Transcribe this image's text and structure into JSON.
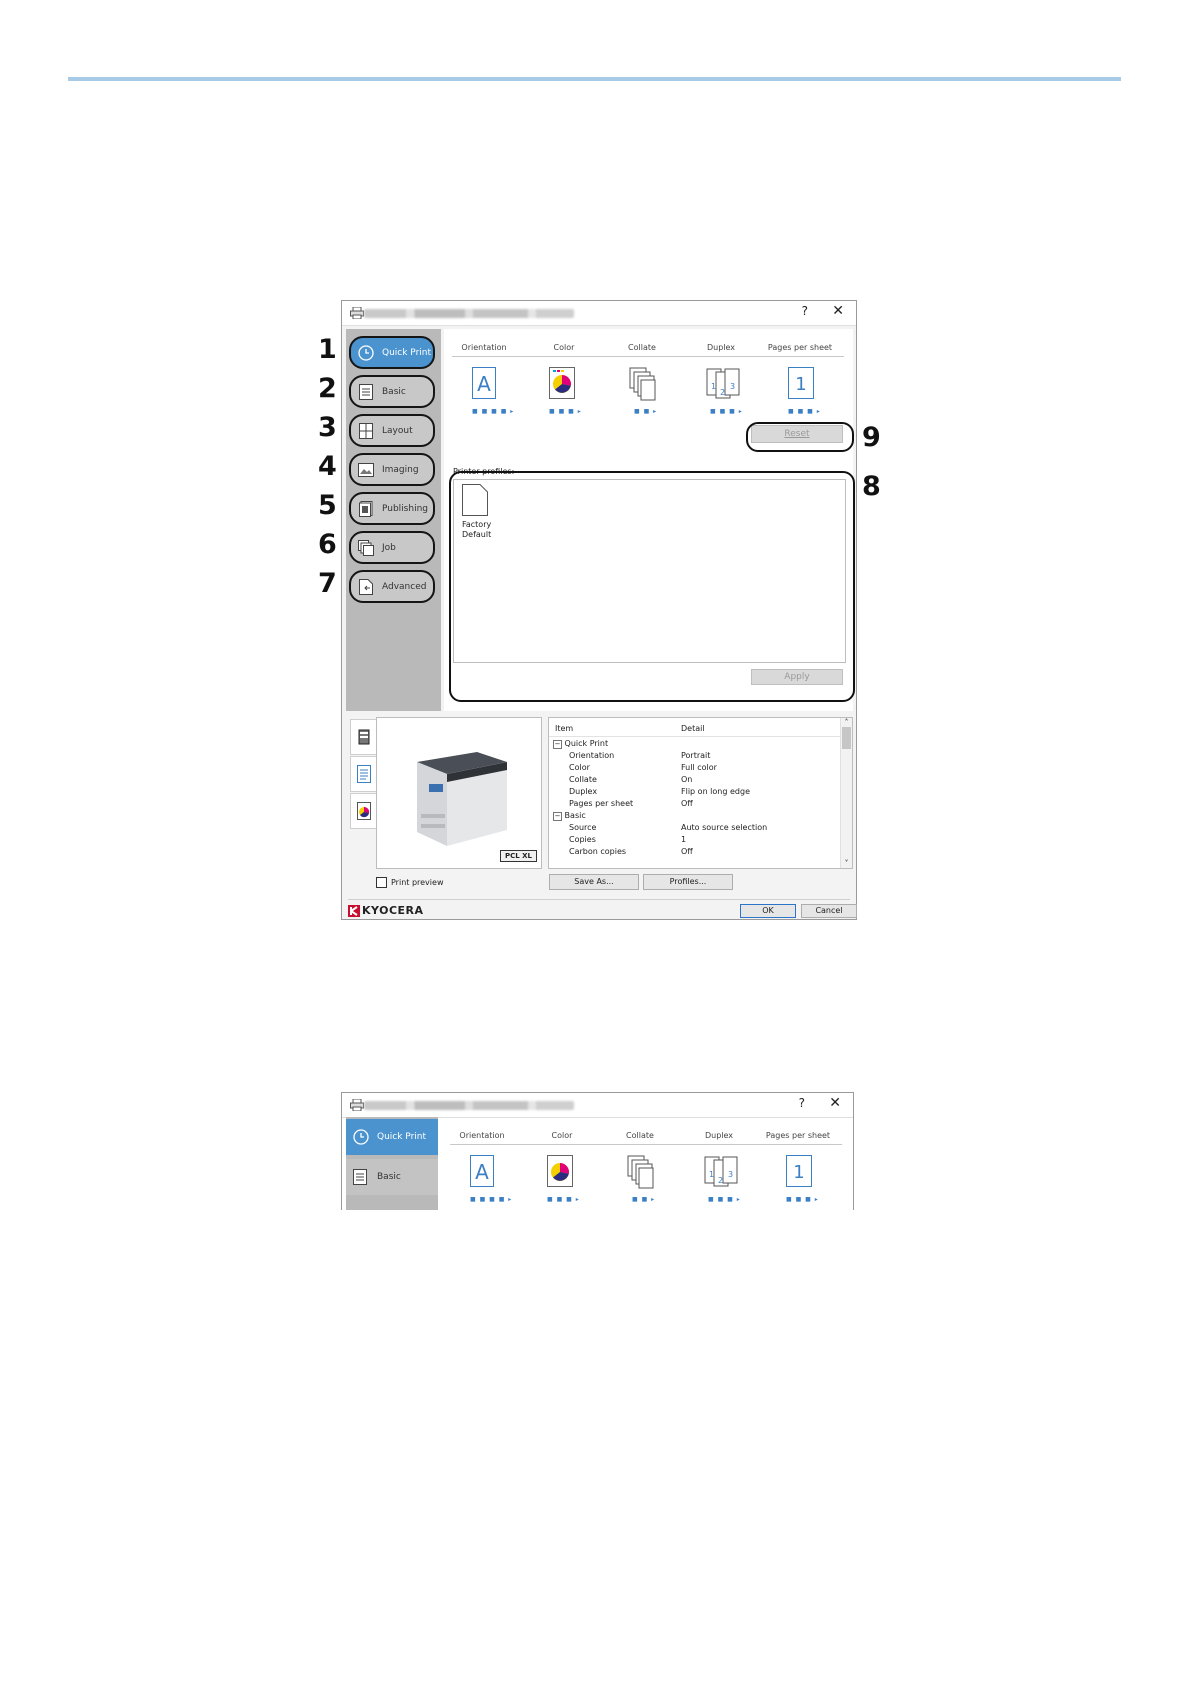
{
  "quick_print_headers": [
    "Orientation",
    "Color",
    "Collate",
    "Duplex",
    "Pages per sheet"
  ],
  "titlebar": {
    "help": "?",
    "close": "✕"
  },
  "nav": [
    {
      "num": "1",
      "label": "Quick Print",
      "icon": "clock-icon"
    },
    {
      "num": "2",
      "label": "Basic",
      "icon": "document-icon"
    },
    {
      "num": "3",
      "label": "Layout",
      "icon": "layout-icon"
    },
    {
      "num": "4",
      "label": "Imaging",
      "icon": "image-icon"
    },
    {
      "num": "5",
      "label": "Publishing",
      "icon": "publishing-icon"
    },
    {
      "num": "6",
      "label": "Job",
      "icon": "job-icon"
    },
    {
      "num": "7",
      "label": "Advanced",
      "icon": "advanced-icon"
    }
  ],
  "callouts": {
    "reset": "9",
    "profiles": "8"
  },
  "icons": {
    "orientation": "A",
    "pages": "1",
    "duplex_n": [
      "1",
      "2",
      "3"
    ]
  },
  "reset_label": "Reset",
  "profiles": {
    "label": "Printer profiles:",
    "item": "Factory Default",
    "item_l1": "Factory",
    "item_l2": "Default",
    "apply": "Apply"
  },
  "preview_badge": "PCL XL",
  "detail_table": {
    "headers": [
      "Item",
      "Detail"
    ],
    "rows": [
      {
        "item": "Quick Print",
        "detail": "",
        "group": true
      },
      {
        "item": "Orientation",
        "detail": "Portrait"
      },
      {
        "item": "Color",
        "detail": "Full color"
      },
      {
        "item": "Collate",
        "detail": "On"
      },
      {
        "item": "Duplex",
        "detail": "Flip on long edge"
      },
      {
        "item": "Pages per sheet",
        "detail": "Off"
      },
      {
        "item": "Basic",
        "detail": "",
        "group": true
      },
      {
        "item": "Source",
        "detail": "Auto source selection"
      },
      {
        "item": "Copies",
        "detail": "1"
      },
      {
        "item": "Carbon copies",
        "detail": "Off"
      }
    ]
  },
  "print_preview": "Print preview",
  "save_as": "Save As...",
  "profiles_btn": "Profiles...",
  "ok": "OK",
  "cancel": "Cancel",
  "brand": "KYOCERA",
  "dialog2_nav": [
    "Quick Print",
    "Basic"
  ],
  "colors": {
    "accent": "#4a93cf",
    "sidebar": "#b9b9b9",
    "topline": "#a7cbe6",
    "brand": "#c8102e"
  }
}
